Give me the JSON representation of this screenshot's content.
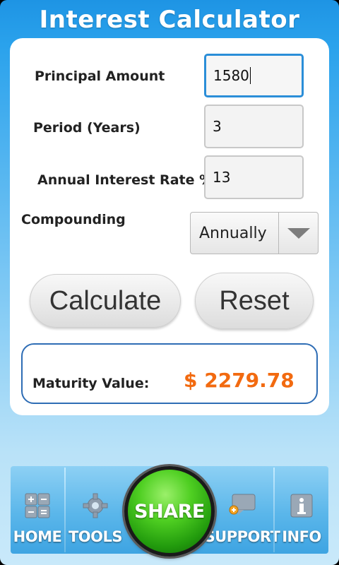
{
  "header": {
    "title": "Interest Calculator"
  },
  "form": {
    "principal": {
      "label": "Principal Amount",
      "value": "1580"
    },
    "period": {
      "label": "Period (Years)",
      "value": "3"
    },
    "rate": {
      "label": "Annual Interest Rate %",
      "value": "13"
    },
    "compounding": {
      "label": "Compounding",
      "selected": "Annually"
    }
  },
  "actions": {
    "calculate_label": "Calculate",
    "reset_label": "Reset"
  },
  "result": {
    "label": "Maturity Value:",
    "value": "$ 2279.78"
  },
  "nav": {
    "home_label": "HOME",
    "tools_label": "TOOLS",
    "share_label": "SHARE",
    "support_label": "SUPPORT",
    "info_label": "INFO"
  },
  "colors": {
    "accent_blue": "#2b8ed8",
    "result_orange": "#f26a10",
    "share_green": "#3fbf1a"
  },
  "icons": {
    "home": "grid-plus-minus-icon",
    "tools": "gear-icon",
    "support": "chat-plus-icon",
    "info": "info-icon",
    "dropdown": "triangle-down-icon"
  }
}
